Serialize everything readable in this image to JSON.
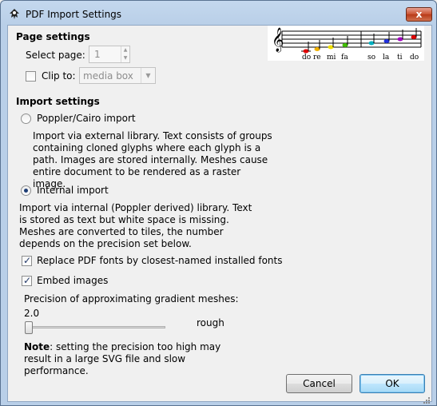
{
  "window": {
    "title": "PDF Import Settings",
    "close_glyph": "x"
  },
  "page_settings": {
    "heading": "Page settings",
    "select_page_label": "Select page:",
    "select_page_value": "1",
    "clip_to_label": "Clip to:",
    "clip_to_value": "media box",
    "clip_to_checked": false
  },
  "music_notes": [
    "do",
    "re",
    "mi",
    "fa",
    "so",
    "la",
    "ti",
    "do"
  ],
  "import_settings": {
    "heading": "Import settings",
    "poppler_label": "Poppler/Cairo import",
    "poppler_desc": "Import via external library. Text consists of groups containing cloned glyphs where each glyph is a path. Images are stored internally. Meshes cause entire document to be rendered as a raster image.",
    "internal_label": "Internal import",
    "internal_desc": "Import via internal (Poppler derived) library. Text is stored as text but white space is missing. Meshes are converted to tiles, the number depends on the precision set below.",
    "selected": "internal",
    "replace_fonts_label": "Replace PDF fonts by closest-named installed fonts",
    "replace_fonts_checked": true,
    "embed_images_label": "Embed images",
    "embed_images_checked": true,
    "precision_label": "Precision of approximating gradient meshes:",
    "precision_value": "2.0",
    "precision_word": "rough",
    "note_bold": "Note",
    "note_text": ": setting the precision too high may result in a large SVG file and slow performance."
  },
  "buttons": {
    "cancel": "Cancel",
    "ok": "OK"
  },
  "colors": {
    "title_bg": "#b9cfe8",
    "close": "#c9502f",
    "radio_dot": "#1d3d75"
  }
}
